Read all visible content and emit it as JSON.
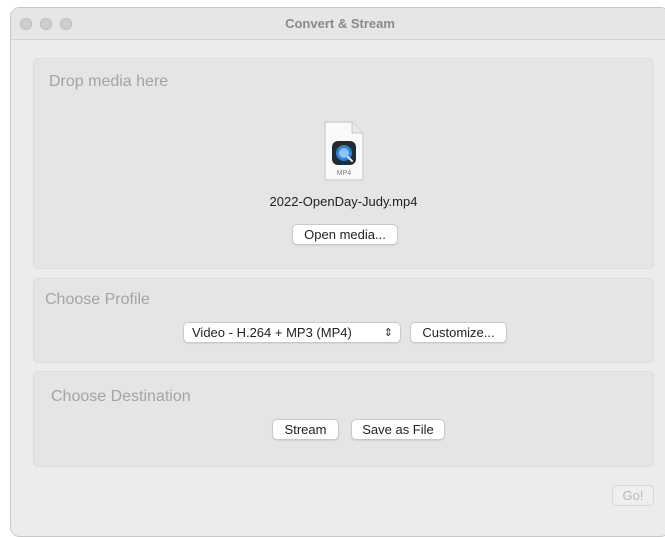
{
  "window": {
    "title": "Convert & Stream"
  },
  "media_panel": {
    "title": "Drop media here",
    "file_icon_label": "MP4",
    "file_name": "2022-OpenDay-Judy.mp4",
    "open_button": "Open media..."
  },
  "profile_panel": {
    "title": "Choose Profile",
    "selected_profile": "Video - H.264 + MP3 (MP4)",
    "customize_button": "Customize..."
  },
  "destination_panel": {
    "title": "Choose Destination",
    "stream_button": "Stream",
    "save_button": "Save as File"
  },
  "footer": {
    "go_button": "Go!"
  },
  "icons": {
    "file": "mp4-file-icon",
    "dropdown": "chevron-updown-icon"
  },
  "colors": {
    "window_bg": "#ececec",
    "panel_bg": "#e5e5e5",
    "panel_title": "#a4a4a4",
    "file_badge": "#2b82d9"
  }
}
